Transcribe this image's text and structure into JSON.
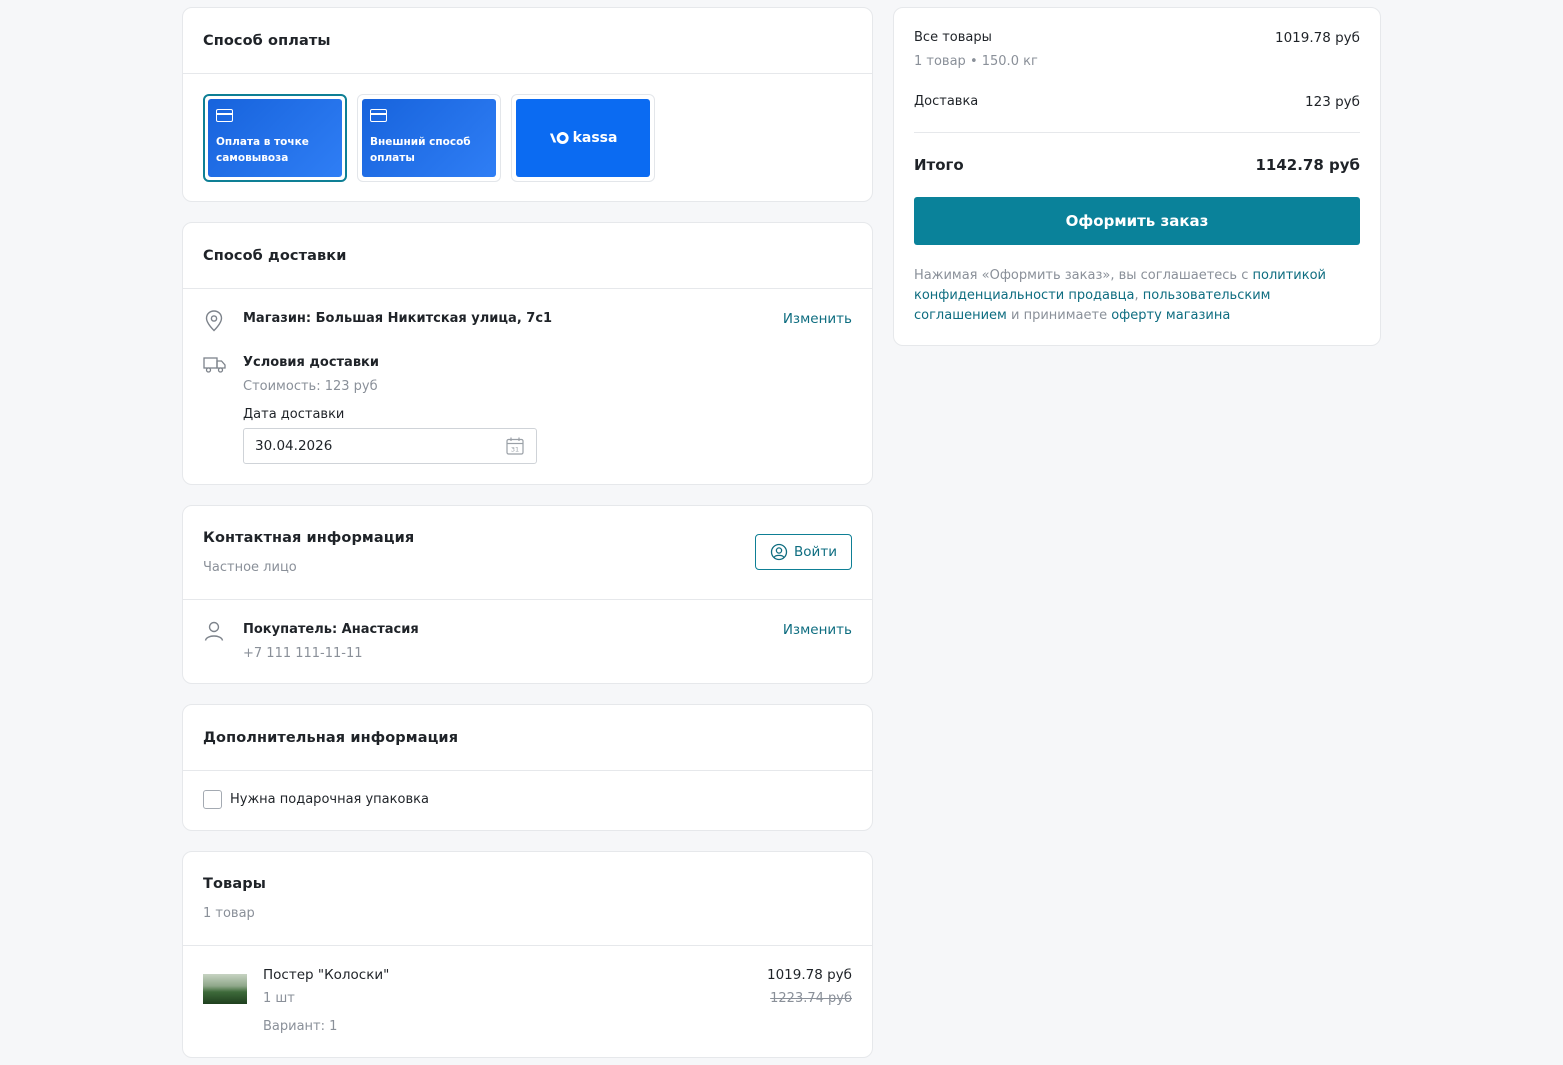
{
  "payment": {
    "title": "Способ оплаты",
    "options": [
      {
        "label": "Оплата в точке самовывоза",
        "selected": true
      },
      {
        "label": "Внешний способ оплаты",
        "selected": false
      },
      {
        "label": "kassa",
        "selected": false
      }
    ]
  },
  "delivery": {
    "title": "Способ доставки",
    "store": "Магазин: Большая Никитская улица, 7с1",
    "change_label": "Изменить",
    "conditions_title": "Условия доставки",
    "cost": "Стоимость: 123 руб",
    "date_label": "Дата доставки",
    "date_value": "30.04.2026"
  },
  "contact": {
    "title": "Контактная информация",
    "subtitle": "Частное лицо",
    "login_label": "Войти",
    "buyer": "Покупатель: Анастасия",
    "phone": "+7 111 111-11-11",
    "change_label": "Изменить"
  },
  "additional": {
    "title": "Дополнительная информация",
    "gift_label": "Нужна подарочная упаковка",
    "gift_checked": false
  },
  "goods": {
    "title": "Товары",
    "count": "1 товар",
    "items": [
      {
        "name": "Постер \"Колоски\"",
        "qty": "1 шт",
        "variant": "Вариант: 1",
        "price": "1019.78 руб",
        "old_price": "1223.74 руб"
      }
    ]
  },
  "summary": {
    "all_goods_label": "Все товары",
    "all_goods_value": "1019.78 руб",
    "goods_meta": "1 товар • 150.0 кг",
    "delivery_label": "Доставка",
    "delivery_value": "123 руб",
    "total_label": "Итого",
    "total_value": "1142.78 руб",
    "order_button": "Оформить заказ",
    "terms_prefix": "Нажимая «Оформить заказ», вы соглашаетесь с ",
    "terms_link1": "политикой конфиденциальности продавца",
    "terms_sep": ", ",
    "terms_link2": "пользовательским соглашением",
    "terms_mid": " и принимаете ",
    "terms_link3": "оферту магазина"
  },
  "colors": {
    "accent": "#0a829a",
    "link": "#0e6d80",
    "payment_blue": "#1763dc",
    "kassa_blue": "#0b6bf2"
  }
}
